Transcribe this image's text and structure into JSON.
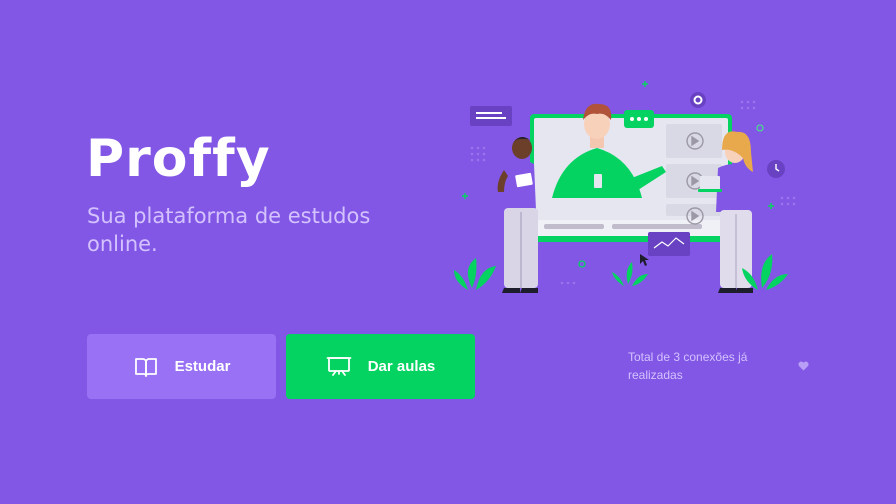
{
  "brand": {
    "name": "Proffy",
    "tagline": "Sua plataforma de estudos online."
  },
  "actions": {
    "study": {
      "label": "Estudar",
      "icon": "book-open-icon"
    },
    "teach": {
      "label": "Dar aulas",
      "icon": "presentation-board-icon"
    }
  },
  "footer": {
    "connections_text": "Total de 3 conexões já realizadas",
    "icon": "purple-heart-icon"
  },
  "colors": {
    "background": "#8257e5",
    "primary_light": "#9871f5",
    "secondary": "#04d361",
    "text_light": "#d4c2ff"
  }
}
